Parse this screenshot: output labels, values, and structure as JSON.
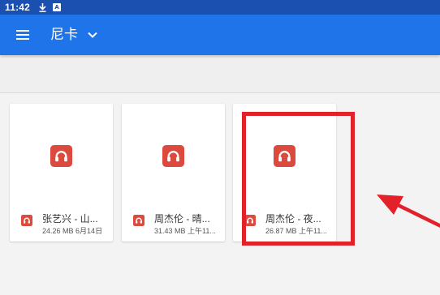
{
  "colors": {
    "status_bar": "#1b4fb0",
    "app_bar": "#1e74e8",
    "audio_icon": "#dc4a3d",
    "annotation": "#e3212b"
  },
  "status_bar": {
    "time": "11:42",
    "icons": [
      "download-icon",
      "a-notification-icon"
    ],
    "notification_letter": "A"
  },
  "app_bar": {
    "menu_icon": "menu-icon",
    "title": "尼卡",
    "dropdown_icon": "chevron-down-icon"
  },
  "files": [
    {
      "icon": "headphones-icon",
      "name": "张艺兴 - 山...",
      "size": "24.26 MB",
      "date": "6月14日"
    },
    {
      "icon": "headphones-icon",
      "name": "周杰伦 - 晴...",
      "size": "31.43 MB",
      "date": "上午11..."
    },
    {
      "icon": "headphones-icon",
      "name": "周杰伦 - 夜...",
      "size": "26.87 MB",
      "date": "上午11..."
    }
  ]
}
